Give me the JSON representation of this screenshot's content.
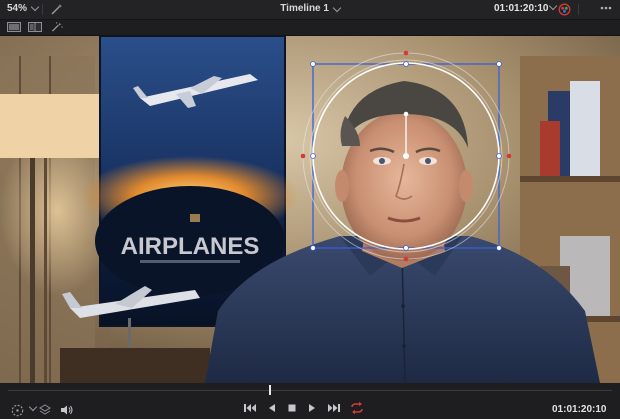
{
  "header": {
    "zoom": "54%",
    "timeline_name": "Timeline 1",
    "timecode": "01:01:20:10"
  },
  "footer": {
    "timecode": "01:01:20:10",
    "playhead_position": 0.432
  },
  "poster": {
    "title": "AIRPLANES"
  },
  "colors": {
    "accent_red": "#d23a3a",
    "window_outline": "#3a5fd6",
    "playhead": "#e8e8ea"
  },
  "icons": [
    "chevron-down-icon",
    "menu-dots-icon",
    "color-wheel-icon",
    "magic-wand-icon",
    "layout-single-icon",
    "layout-dual-icon",
    "power-window-icon",
    "layers-icon",
    "speaker-icon",
    "skip-back-icon",
    "play-reverse-icon",
    "stop-icon",
    "play-icon",
    "skip-forward-icon",
    "loop-icon"
  ]
}
